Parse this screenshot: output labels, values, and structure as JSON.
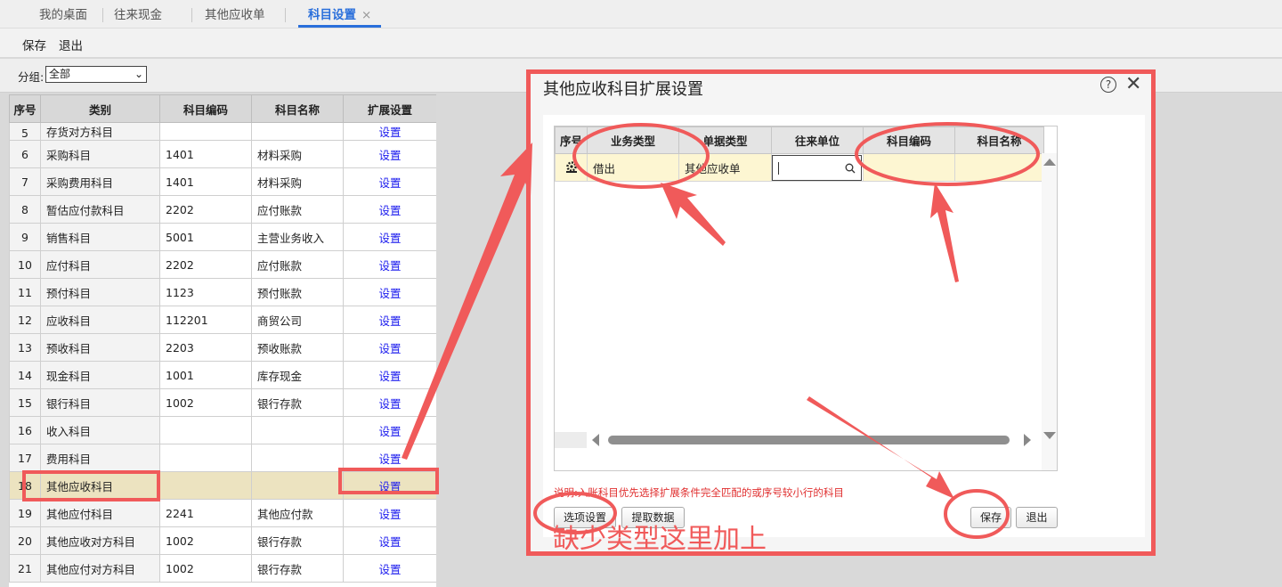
{
  "tabs": [
    {
      "label": "我的桌面"
    },
    {
      "label": "往来现金"
    },
    {
      "label": "其他应收单"
    },
    {
      "label": "科目设置",
      "close": "×"
    }
  ],
  "toolbar": {
    "save_label": "保存",
    "exit_label": "退出"
  },
  "filter": {
    "label": "分组:",
    "value": "全部"
  },
  "grid": {
    "headers": [
      "序号",
      "类别",
      "科目编码",
      "科目名称",
      "扩展设置"
    ],
    "partial_top": {
      "seq": "5",
      "category": "存货对方科目",
      "link": "设置"
    },
    "rows": [
      {
        "seq": "6",
        "category": "采购科目",
        "code": "1401",
        "name": "材料采购",
        "link": "设置"
      },
      {
        "seq": "7",
        "category": "采购费用科目",
        "code": "1401",
        "name": "材料采购",
        "link": "设置"
      },
      {
        "seq": "8",
        "category": "暂估应付款科目",
        "code": "2202",
        "name": "应付账款",
        "link": "设置"
      },
      {
        "seq": "9",
        "category": "销售科目",
        "code": "5001",
        "name": "主营业务收入",
        "link": "设置"
      },
      {
        "seq": "10",
        "category": "应付科目",
        "code": "2202",
        "name": "应付账款",
        "link": "设置"
      },
      {
        "seq": "11",
        "category": "预付科目",
        "code": "1123",
        "name": "预付账款",
        "link": "设置"
      },
      {
        "seq": "12",
        "category": "应收科目",
        "code": "112201",
        "name": "商贸公司",
        "link": "设置"
      },
      {
        "seq": "13",
        "category": "预收科目",
        "code": "2203",
        "name": "预收账款",
        "link": "设置"
      },
      {
        "seq": "14",
        "category": "现金科目",
        "code": "1001",
        "name": "库存现金",
        "link": "设置"
      },
      {
        "seq": "15",
        "category": "银行科目",
        "code": "1002",
        "name": "银行存款",
        "link": "设置"
      },
      {
        "seq": "16",
        "category": "收入科目",
        "code": "",
        "name": "",
        "link": "设置"
      },
      {
        "seq": "17",
        "category": "费用科目",
        "code": "",
        "name": "",
        "link": "设置"
      },
      {
        "seq": "18",
        "category": "其他应收科目",
        "code": "",
        "name": "",
        "link": "设置"
      },
      {
        "seq": "19",
        "category": "其他应付科目",
        "code": "2241",
        "name": "其他应付款",
        "link": "设置"
      },
      {
        "seq": "20",
        "category": "其他应收对方科目",
        "code": "1002",
        "name": "银行存款",
        "link": "设置"
      },
      {
        "seq": "21",
        "category": "其他应付对方科目",
        "code": "1002",
        "name": "银行存款",
        "link": "设置"
      }
    ]
  },
  "dialog": {
    "title": "其他应收科目扩展设置",
    "help": "?",
    "close": "✕",
    "table": {
      "headers": [
        "序号",
        "业务类型",
        "单据类型",
        "往来单位",
        "科目编码",
        "科目名称"
      ],
      "row": {
        "biz_type": "借出",
        "doc_type": "其他应收单",
        "partner": "",
        "code": "",
        "name": ""
      }
    },
    "note": "说明:入账科目优先选择扩展条件完全匹配的或序号较小行的科目",
    "buttons": {
      "options": "选项设置",
      "fetch": "提取数据",
      "save": "保存",
      "exit": "退出"
    }
  },
  "annotation": {
    "text": "缺少类型这里加上",
    "color": "#f05a5a"
  },
  "colors": {
    "accent": "#2a6fdb",
    "link": "#1a1aee",
    "highlight_row": "#ece3c0",
    "annotation": "#f05a5a"
  }
}
